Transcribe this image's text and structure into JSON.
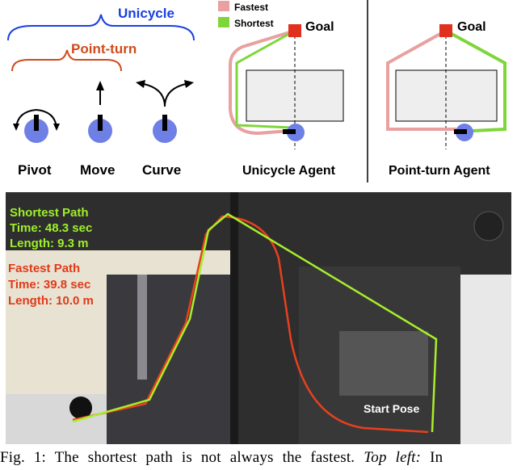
{
  "top_left": {
    "unicycle_label": "Unicycle",
    "pointturn_label": "Point-turn",
    "actions": [
      "Pivot",
      "Move",
      "Curve"
    ]
  },
  "legend": {
    "fastest": "Fastest",
    "shortest": "Shortest"
  },
  "unicycle_panel": {
    "goal_label": "Goal",
    "title": "Unicycle Agent"
  },
  "pointturn_panel": {
    "goal_label": "Goal",
    "title": "Point-turn Agent"
  },
  "photo": {
    "shortest": {
      "title": "Shortest Path",
      "time": "Time: 48.3 sec",
      "length": "Length: 9.3 m"
    },
    "fastest": {
      "title": "Fastest Path",
      "time": "Time: 39.8 sec",
      "length": "Length: 10.0 m"
    },
    "start_label": "Start Pose"
  },
  "caption": {
    "text": "Fig. 1: The shortest path is not always the fastest.",
    "italic": "Top left:",
    "tail": "In"
  },
  "colors": {
    "unicycle": "#1a3fe0",
    "pointturn": "#d04a1a",
    "agent": "#6e7fe6",
    "goal": "#e0301e",
    "fastest": "#e8a0a0",
    "shortest": "#7ed63a",
    "fastest_photo": "#e8401e",
    "shortest_photo": "#a8ee2a"
  }
}
